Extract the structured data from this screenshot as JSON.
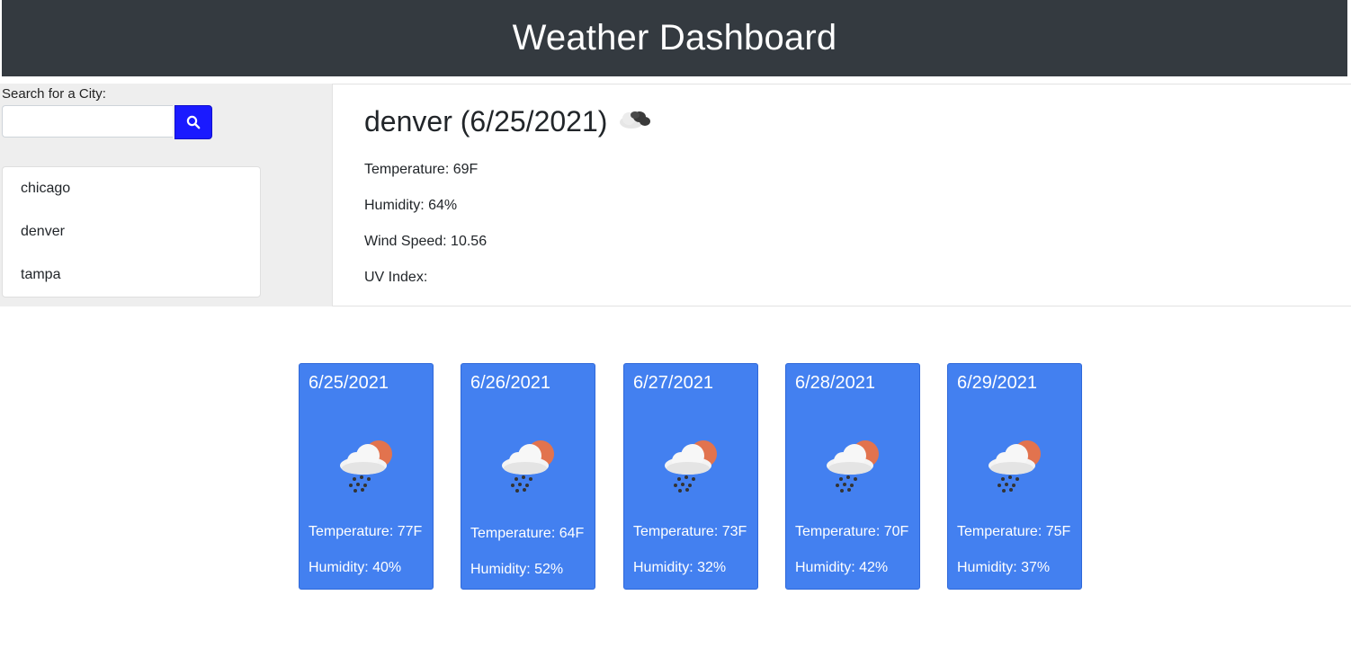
{
  "header": {
    "title": "Weather Dashboard"
  },
  "search": {
    "label": "Search for a City:",
    "value": "",
    "button_icon": "search-icon"
  },
  "history": [
    "chicago",
    "denver",
    "tampa"
  ],
  "current": {
    "title": "denver (6/25/2021)",
    "icon": "cloudy-icon",
    "temperature": "Temperature: 69F",
    "humidity": "Humidity: 64%",
    "wind": "Wind Speed: 10.56",
    "uv": "UV Index:"
  },
  "forecast": [
    {
      "date": "6/25/2021",
      "icon": "rain-cloud-sun-icon",
      "temperature": "Temperature: 77F",
      "humidity": "Humidity: 40%"
    },
    {
      "date": "6/26/2021",
      "icon": "rain-cloud-sun-icon",
      "temperature": "Temperature: 64F",
      "humidity": "Humidity: 52%"
    },
    {
      "date": "6/27/2021",
      "icon": "rain-cloud-sun-icon",
      "temperature": "Temperature: 73F",
      "humidity": "Humidity: 32%"
    },
    {
      "date": "6/28/2021",
      "icon": "rain-cloud-sun-icon",
      "temperature": "Temperature: 70F",
      "humidity": "Humidity: 42%"
    },
    {
      "date": "6/29/2021",
      "icon": "rain-cloud-sun-icon",
      "temperature": "Temperature: 75F",
      "humidity": "Humidity: 37%"
    }
  ],
  "colors": {
    "header_bg": "#343a40",
    "search_button": "#1a1aff",
    "card_bg": "#4380f0",
    "sidebar_bg": "#eeeeee"
  }
}
